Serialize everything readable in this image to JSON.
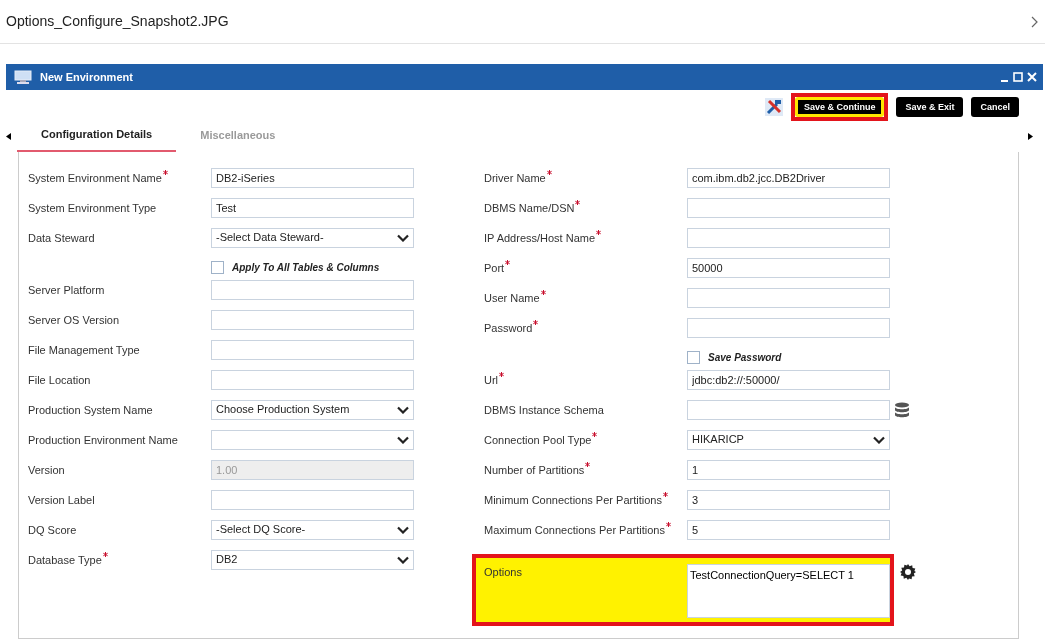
{
  "viewer": {
    "file_name": "Options_Configure_Snapshot2.JPG"
  },
  "window": {
    "title": "New Environment"
  },
  "toolbar": {
    "buttons": [
      {
        "label": "Save & Continue",
        "highlighted": true
      },
      {
        "label": "Save & Exit",
        "highlighted": false
      },
      {
        "label": "Cancel",
        "highlighted": false
      }
    ]
  },
  "tabs": [
    {
      "label": "Configuration Details",
      "selected": true
    },
    {
      "label": "Miscellaneous",
      "selected": false
    }
  ],
  "left_fields": [
    {
      "kind": "text",
      "label": "System Environment Name",
      "required": true,
      "disabled": false,
      "value": "DB2-iSeries"
    },
    {
      "kind": "text",
      "label": "System Environment Type",
      "required": false,
      "disabled": false,
      "value": "Test"
    },
    {
      "kind": "select",
      "label": "Data Steward",
      "required": false,
      "disabled": false,
      "value": "-Select Data Steward-"
    },
    {
      "kind": "checkbox",
      "label": "Apply To All Tables & Columns",
      "checked": false
    },
    {
      "kind": "text",
      "label": "Server Platform",
      "required": false,
      "disabled": false
    },
    {
      "kind": "text",
      "label": "Server OS Version",
      "required": false,
      "disabled": false
    },
    {
      "kind": "text",
      "label": "File Management Type",
      "required": false,
      "disabled": false
    },
    {
      "kind": "text",
      "label": "File Location",
      "required": false,
      "disabled": false
    },
    {
      "kind": "select",
      "label": "Production System Name",
      "required": false,
      "disabled": false,
      "value": "Choose Production System"
    },
    {
      "kind": "select",
      "label": "Production Environment Name",
      "required": false,
      "disabled": false
    },
    {
      "kind": "text",
      "label": "Version",
      "required": false,
      "disabled": true,
      "value": "1.00"
    },
    {
      "kind": "text",
      "label": "Version Label",
      "required": false,
      "disabled": false
    },
    {
      "kind": "select",
      "label": "DQ Score",
      "required": false,
      "disabled": false,
      "value": "-Select DQ Score-"
    },
    {
      "kind": "select",
      "label": "Database Type",
      "required": true,
      "disabled": false,
      "value": "DB2"
    }
  ],
  "right_fields": [
    {
      "kind": "text",
      "label": "Driver Name",
      "required": true,
      "highlighted": false,
      "value": "com.ibm.db2.jcc.DB2Driver"
    },
    {
      "kind": "text",
      "label": "DBMS Name/DSN",
      "required": true,
      "highlighted": false
    },
    {
      "kind": "text",
      "label": "IP Address/Host Name",
      "required": true,
      "highlighted": false
    },
    {
      "kind": "text",
      "label": "Port",
      "required": true,
      "highlighted": false,
      "value": "50000"
    },
    {
      "kind": "text",
      "label": "User Name",
      "required": true,
      "highlighted": false
    },
    {
      "kind": "text",
      "label": "Password",
      "required": true,
      "highlighted": false
    },
    {
      "kind": "checkbox",
      "label": "Save Password",
      "checked": false,
      "highlighted": false
    },
    {
      "kind": "text",
      "label": "Url",
      "required": true,
      "highlighted": false,
      "value": "jdbc:db2://:50000/"
    },
    {
      "kind": "lookup",
      "label": "DBMS Instance Schema",
      "required": false,
      "highlighted": false
    },
    {
      "kind": "select",
      "label": "Connection Pool Type",
      "required": true,
      "highlighted": false,
      "value": "HIKARICP"
    },
    {
      "kind": "text",
      "label": "Number of Partitions",
      "required": true,
      "highlighted": false,
      "value": "1"
    },
    {
      "kind": "text",
      "label": "Minimum Connections Per Partitions",
      "required": true,
      "highlighted": false,
      "value": "3"
    },
    {
      "kind": "text",
      "label": "Maximum Connections Per Partitions",
      "required": true,
      "highlighted": false,
      "value": "5"
    },
    {
      "kind": "options",
      "label": "Options",
      "required": false,
      "highlighted": true,
      "value": "TestConnectionQuery=SELECT 1"
    }
  ]
}
